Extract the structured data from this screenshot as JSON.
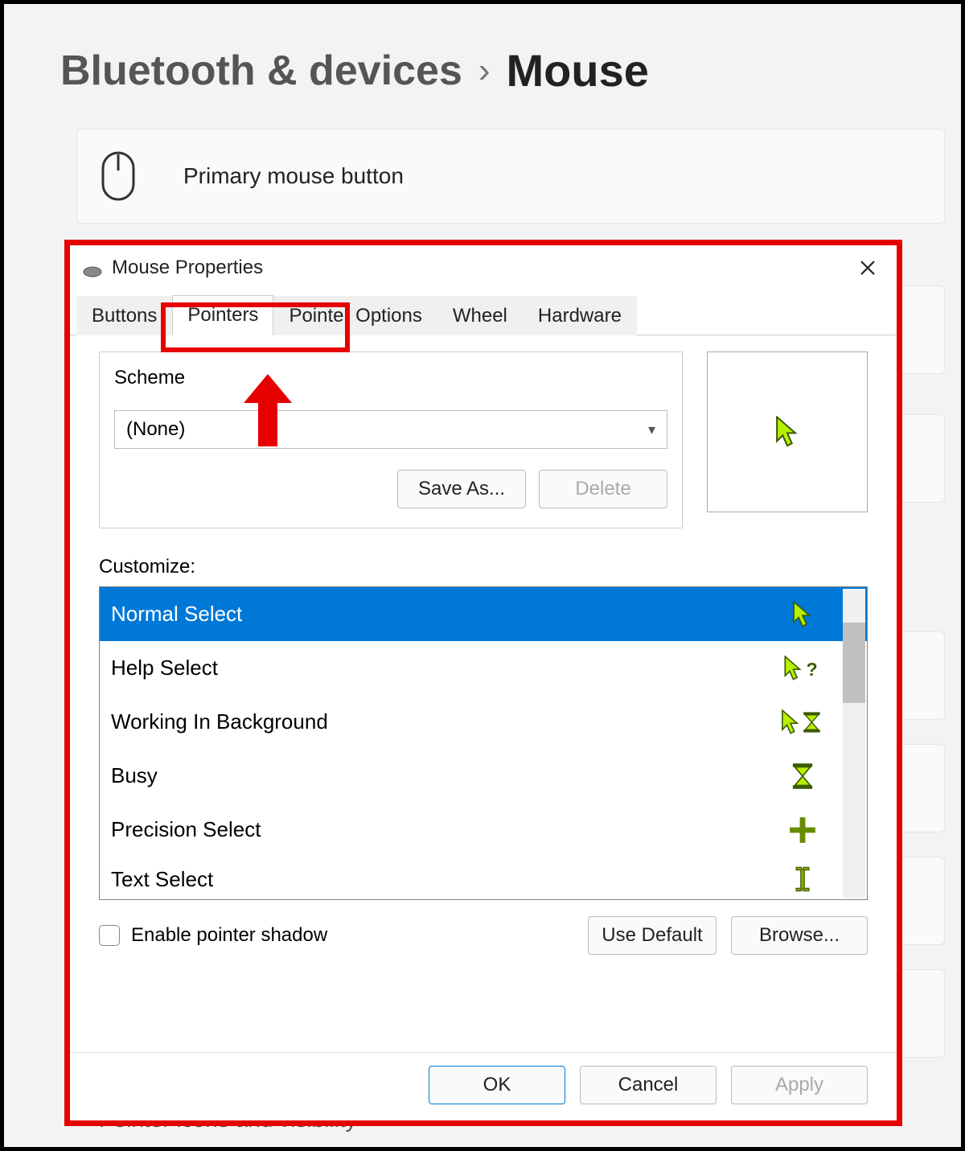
{
  "breadcrumb": {
    "parent": "Bluetooth & devices",
    "current": "Mouse"
  },
  "card": {
    "label": "Primary mouse button"
  },
  "footer_text": "Pointer icons and visibility",
  "dialog": {
    "title": "Mouse Properties",
    "tabs": [
      "Buttons",
      "Pointers",
      "Pointer Options",
      "Wheel",
      "Hardware"
    ],
    "scheme": {
      "legend": "Scheme",
      "value": "(None)",
      "save_as": "Save As...",
      "delete": "Delete"
    },
    "customize_label": "Customize:",
    "items": [
      "Normal Select",
      "Help Select",
      "Working In Background",
      "Busy",
      "Precision Select",
      "Text Select"
    ],
    "enable_shadow": "Enable pointer shadow",
    "use_default": "Use Default",
    "browse": "Browse...",
    "ok": "OK",
    "cancel": "Cancel",
    "apply": "Apply"
  }
}
